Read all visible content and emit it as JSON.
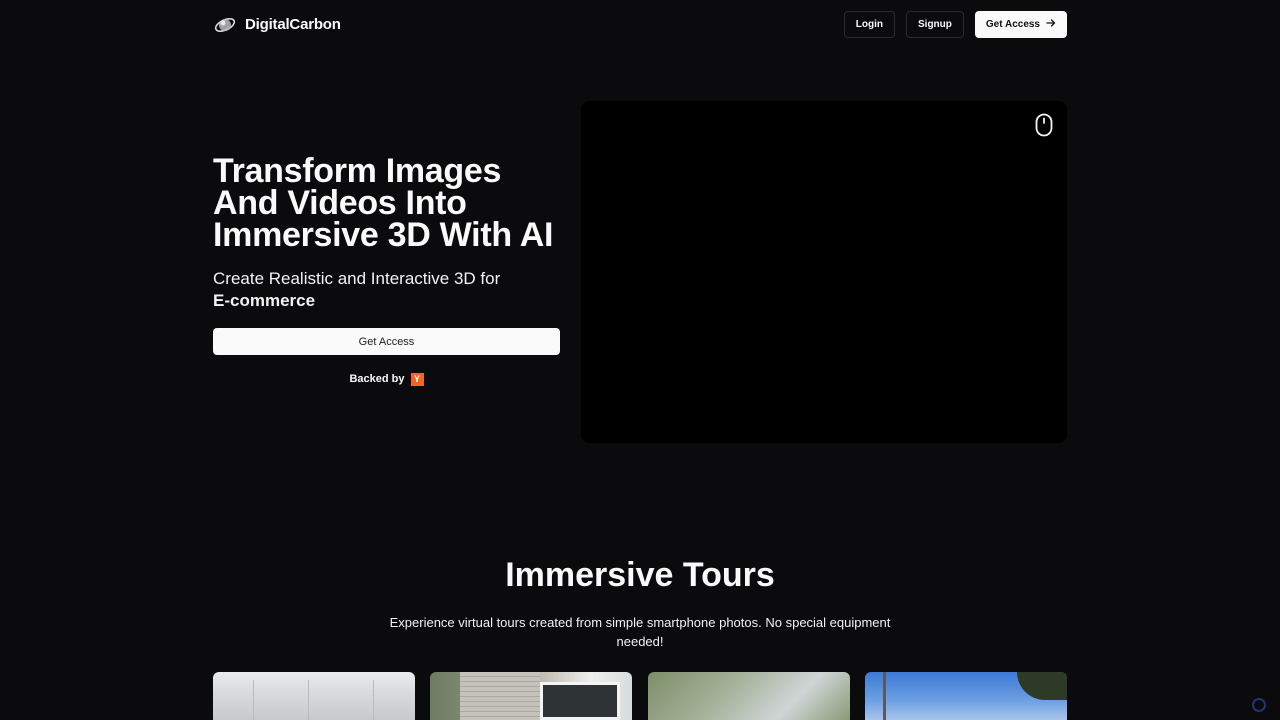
{
  "brand": {
    "name": "DigitalCarbon",
    "logo_icon": "orbit-logo-icon"
  },
  "nav": {
    "login_label": "Login",
    "signup_label": "Signup",
    "get_access_label": "Get Access",
    "get_access_icon": "arrow-right-icon"
  },
  "hero": {
    "title_line1": "Transform Images",
    "title_line2": "And Videos Into",
    "title_line3": "Immersive 3D With AI",
    "subtitle": "Create Realistic and Interactive 3D for",
    "subtitle_emphasis": "E-commerce",
    "cta_label": "Get Access",
    "backed_by_label": "Backed by",
    "backer_badge": "Y"
  },
  "viewer": {
    "icon": "mouse-icon"
  },
  "tours_section": {
    "title": "Immersive Tours",
    "description": "Experience virtual tours created from simple smartphone photos. No special equipment needed!"
  },
  "colors": {
    "background": "#0b0b0e",
    "foreground": "#fafafa",
    "button_solid": "#fafafa",
    "yc_orange": "#f26522",
    "viewer_bg": "#000000"
  }
}
